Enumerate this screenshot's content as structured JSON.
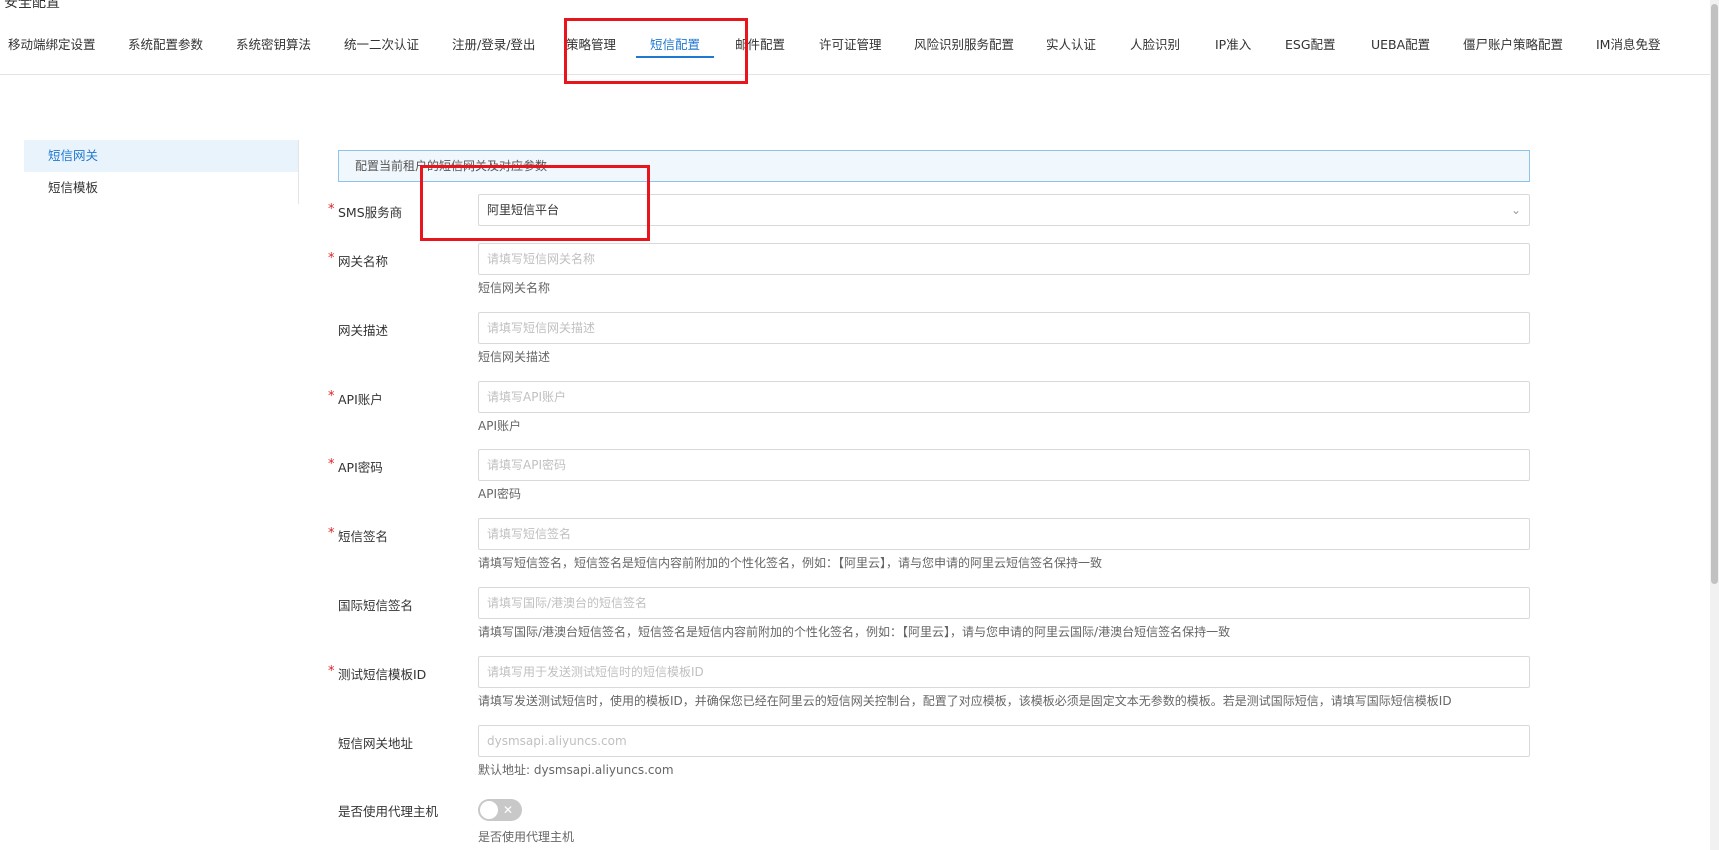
{
  "header": {
    "title": "安全配置"
  },
  "tabs": [
    "移动端绑定设置",
    "系统配置参数",
    "系统密钥算法",
    "统一二次认证",
    "注册/登录/登出",
    "策略管理",
    "短信配置",
    "邮件配置",
    "许可证管理",
    "风险识别服务配置",
    "实人认证",
    "人脸识别",
    "IP准入",
    "ESG配置",
    "UEBA配置",
    "僵尸账户策略配置",
    "IM消息免登"
  ],
  "active_tab": "短信配置",
  "sidebar": {
    "items": [
      "短信网关",
      "短信模板"
    ],
    "active": "短信网关"
  },
  "info_text": "配置当前租户的短信网关及对应参数",
  "form": {
    "sms_provider": {
      "label": "SMS服务商",
      "value": "阿里短信平台"
    },
    "gateway_name": {
      "label": "网关名称",
      "placeholder": "请填写短信网关名称",
      "help": "短信网关名称"
    },
    "gateway_desc": {
      "label": "网关描述",
      "placeholder": "请填写短信网关描述",
      "help": "短信网关描述"
    },
    "api_account": {
      "label": "API账户",
      "placeholder": "请填写API账户",
      "help": "API账户"
    },
    "api_password": {
      "label": "API密码",
      "placeholder": "请填写API密码",
      "help": "API密码"
    },
    "sms_signature": {
      "label": "短信签名",
      "placeholder": "请填写短信签名",
      "help": "请填写短信签名，短信签名是短信内容前附加的个性化签名，例如：【阿里云】，请与您申请的阿里云短信签名保持一致"
    },
    "intl_signature": {
      "label": "国际短信签名",
      "placeholder": "请填写国际/港澳台的短信签名",
      "help": "请填写国际/港澳台短信签名，短信签名是短信内容前附加的个性化签名，例如：【阿里云】，请与您申请的阿里云国际/港澳台短信签名保持一致"
    },
    "test_template_id": {
      "label": "测试短信模板ID",
      "placeholder": "请填写用于发送测试短信时的短信模板ID",
      "help": "请填写发送测试短信时，使用的模板ID，并确保您已经在阿里云的短信网关控制台，配置了对应模板，该模板必须是固定文本无参数的模板。若是测试国际短信，请填写国际短信模板ID"
    },
    "gateway_address": {
      "label": "短信网关地址",
      "placeholder": "dysmsapi.aliyuncs.com",
      "help": "默认地址: dysmsapi.aliyuncs.com"
    },
    "use_proxy": {
      "label": "是否使用代理主机",
      "toggle_symbol": "✕",
      "help": "是否使用代理主机"
    }
  },
  "icons": {
    "chevron": "chevron-down-icon",
    "toggle_off": "close-icon"
  },
  "colors": {
    "accent": "#1f78d1",
    "annotation": "#e8161c",
    "required": "#e02020"
  }
}
